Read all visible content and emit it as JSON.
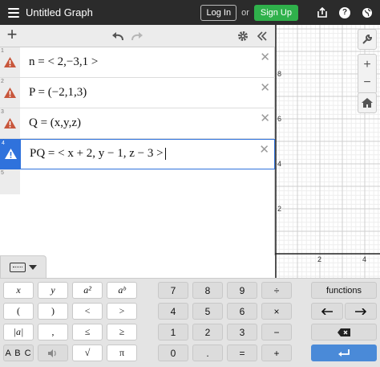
{
  "header": {
    "title": "Untitled Graph",
    "login_label": "Log In",
    "or_label": "or",
    "signup_label": "Sign Up"
  },
  "expressions": [
    {
      "num": "1",
      "text": "n = < 2,−3,1 >"
    },
    {
      "num": "2",
      "text": "P = (−2,1,3)"
    },
    {
      "num": "3",
      "text": "Q = (x,y,z)"
    },
    {
      "num": "4",
      "text": "PQ = < x + 2, y − 1, z − 3 >"
    },
    {
      "num": "5",
      "text": ""
    }
  ],
  "graph": {
    "y_ticks": [
      "8",
      "6",
      "4",
      "2"
    ],
    "x_ticks": [
      "2",
      "4"
    ]
  },
  "keypad": {
    "left": [
      [
        "x",
        "y",
        "a²",
        "aᵇ"
      ],
      [
        "(",
        ")",
        "<",
        ">"
      ],
      [
        "|a|",
        ",",
        "≤",
        "≥"
      ],
      [
        "A B C",
        "🔊",
        "√",
        "π"
      ]
    ],
    "numbers": [
      [
        "7",
        "8",
        "9",
        "÷"
      ],
      [
        "4",
        "5",
        "6",
        "×"
      ],
      [
        "1",
        "2",
        "3",
        "−"
      ],
      [
        "0",
        ".",
        "=",
        "+"
      ]
    ],
    "functions_label": "functions"
  },
  "colors": {
    "accent": "#2f72dc",
    "warning": "#c8573c",
    "signup": "#2fb14b",
    "enter": "#4a8ad8"
  }
}
